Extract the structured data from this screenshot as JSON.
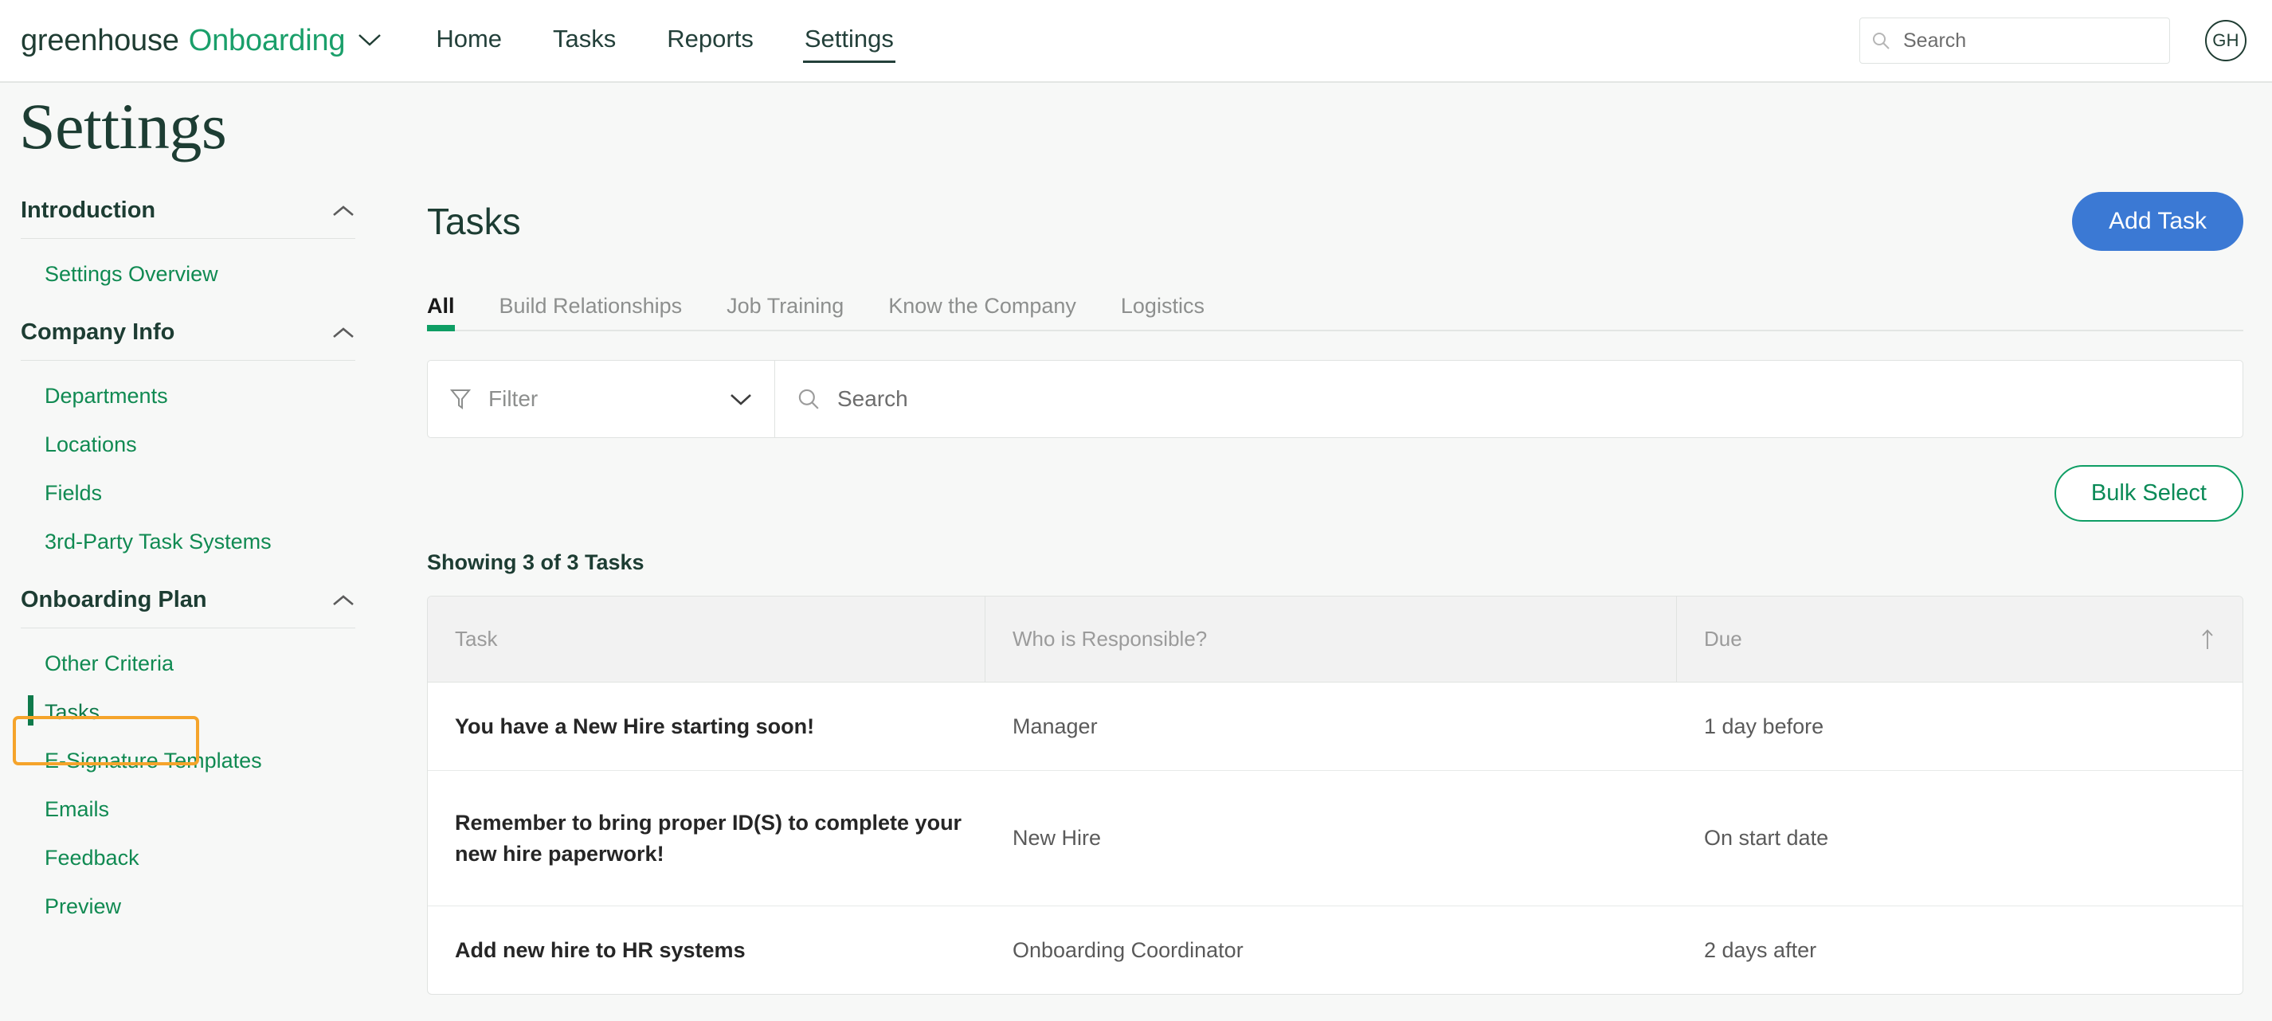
{
  "header": {
    "brand_name": "greenhouse",
    "brand_product": "Onboarding",
    "brand_caret_icon": "chevron-down-icon",
    "nav": [
      {
        "label": "Home",
        "active": false
      },
      {
        "label": "Tasks",
        "active": false
      },
      {
        "label": "Reports",
        "active": false
      },
      {
        "label": "Settings",
        "active": true
      }
    ],
    "search": {
      "icon": "search-icon",
      "placeholder": "Search",
      "value": ""
    },
    "avatar_initials": "GH"
  },
  "page": {
    "title": "Settings"
  },
  "sidebar": {
    "sections": [
      {
        "title": "Introduction",
        "collapse_icon": "chevron-up-icon",
        "items": [
          {
            "label": "Settings Overview",
            "active": false
          }
        ]
      },
      {
        "title": "Company Info",
        "collapse_icon": "chevron-up-icon",
        "items": [
          {
            "label": "Departments",
            "active": false
          },
          {
            "label": "Locations",
            "active": false
          },
          {
            "label": "Fields",
            "active": false
          },
          {
            "label": "3rd-Party Task Systems",
            "active": false
          }
        ]
      },
      {
        "title": "Onboarding Plan",
        "collapse_icon": "chevron-up-icon",
        "items": [
          {
            "label": "Other Criteria",
            "active": false
          },
          {
            "label": "Tasks",
            "active": true
          },
          {
            "label": "E-Signature Templates",
            "active": false
          },
          {
            "label": "Emails",
            "active": false
          },
          {
            "label": "Feedback",
            "active": false
          },
          {
            "label": "Preview",
            "active": false
          }
        ]
      }
    ],
    "highlight_color": "#f5a42b",
    "link_color": "#108a52"
  },
  "main": {
    "title": "Tasks",
    "add_button": "Add Task",
    "add_button_color": "#3b79d4",
    "tabs": [
      {
        "label": "All",
        "active": true
      },
      {
        "label": "Build Relationships",
        "active": false
      },
      {
        "label": "Job Training",
        "active": false
      },
      {
        "label": "Know the Company",
        "active": false
      },
      {
        "label": "Logistics",
        "active": false
      }
    ],
    "filter": {
      "icon": "funnel-icon",
      "label": "Filter",
      "caret_icon": "chevron-down-icon"
    },
    "search": {
      "icon": "search-icon",
      "placeholder": "Search",
      "value": ""
    },
    "bulk_select_button": "Bulk Select",
    "bulk_select_color": "#0e9e64",
    "showing_text": "Showing 3 of 3 Tasks",
    "table": {
      "columns": [
        {
          "label": "Task",
          "sort_icon": ""
        },
        {
          "label": "Who is Responsible?",
          "sort_icon": ""
        },
        {
          "label": "Due",
          "sort_icon": "arrow-up-icon"
        }
      ],
      "rows": [
        {
          "task": "You have a New Hire starting soon!",
          "responsible": "Manager",
          "due": "1 day before"
        },
        {
          "task": "Remember to bring proper ID(S) to complete your new hire paperwork!",
          "responsible": "New Hire",
          "due": "On start date"
        },
        {
          "task": "Add new hire to HR systems",
          "responsible": "Onboarding Coordinator",
          "due": "2 days after"
        }
      ]
    }
  }
}
